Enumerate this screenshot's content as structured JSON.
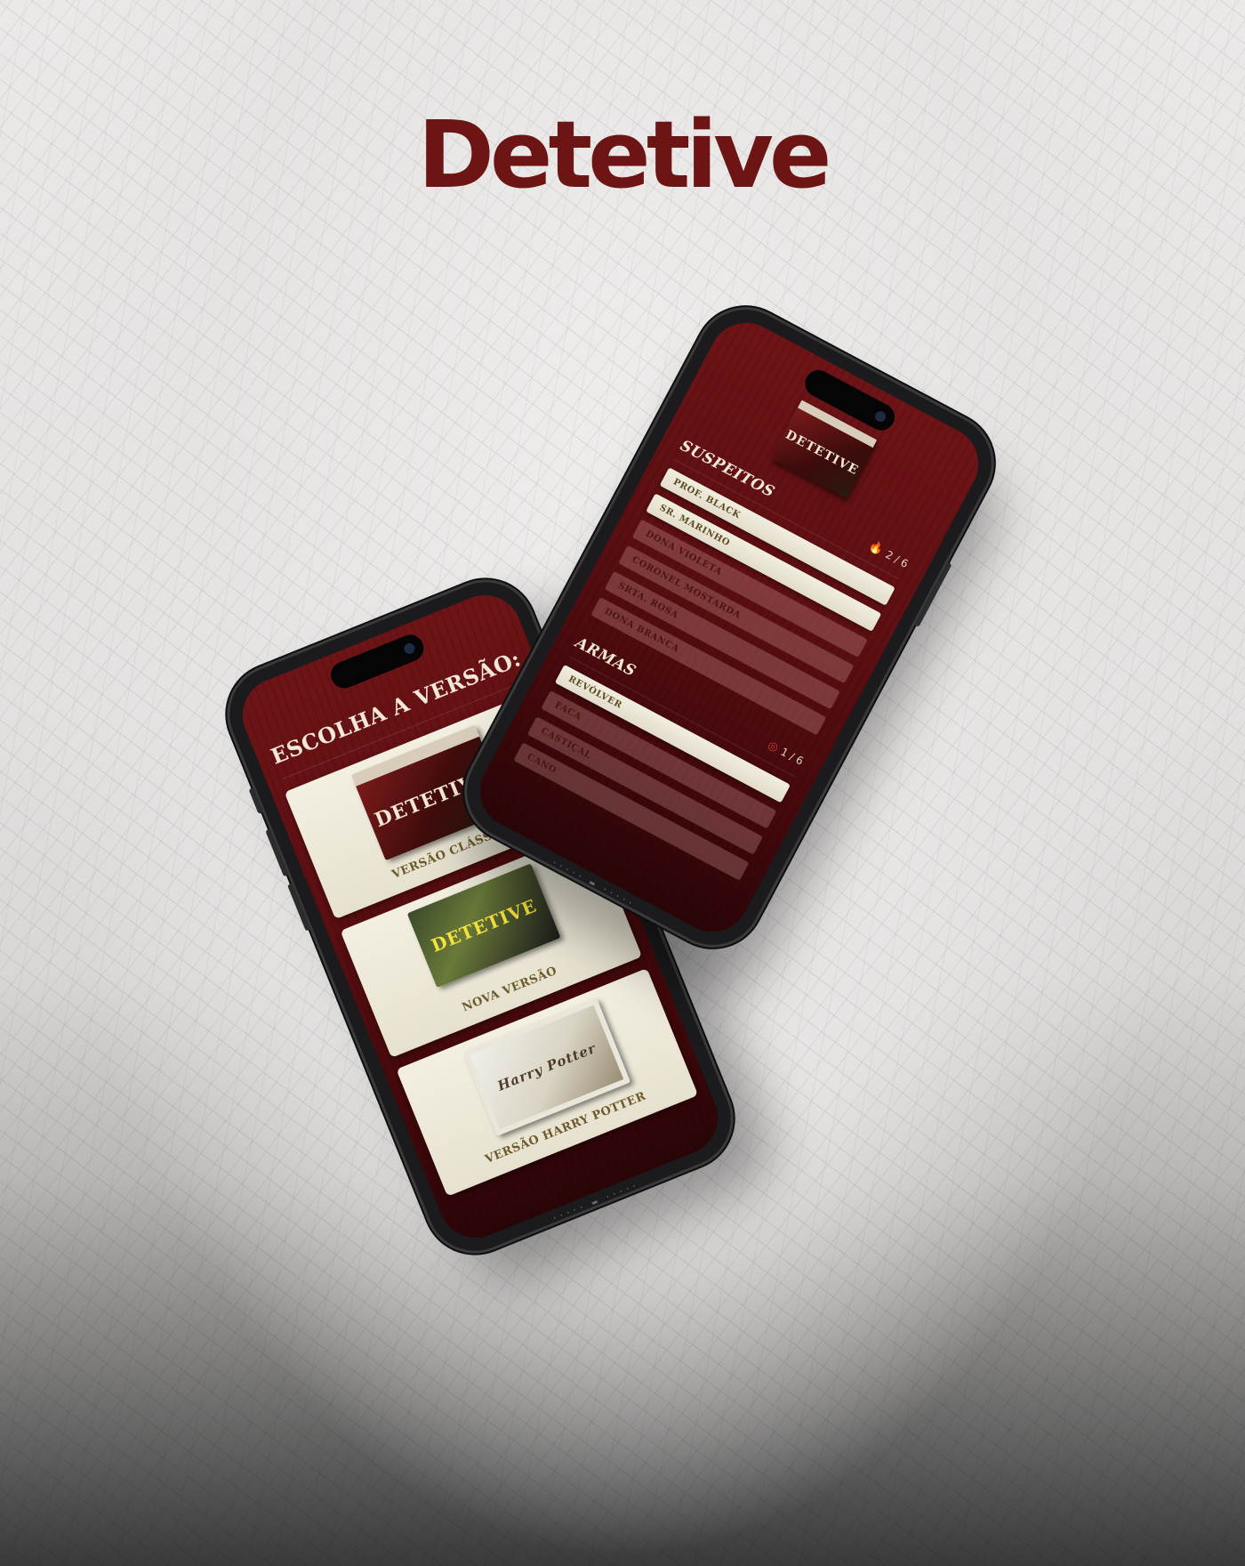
{
  "brand": {
    "title": "Detetive"
  },
  "version_screen": {
    "title": "ESCOLHA A VERSÃO:",
    "versions": [
      {
        "label": "VERSÃO CLÁSSICA",
        "box_text": "DETETIVE"
      },
      {
        "label": "NOVA VERSÃO",
        "box_text": "DETETIVE"
      },
      {
        "label": "VERSÃO HARRY POTTER",
        "box_text": "Harry Potter"
      }
    ]
  },
  "game_screen": {
    "cover_text": "DETETIVE",
    "suspects": {
      "title": "SUSPEITOS",
      "count": "2 / 6",
      "icon": "flame-icon",
      "items": [
        {
          "label": "PROF. BLACK",
          "selected": true
        },
        {
          "label": "SR. MARINHO",
          "selected": true
        },
        {
          "label": "DONA VIOLETA",
          "selected": false
        },
        {
          "label": "CORONEL MOSTARDA",
          "selected": false
        },
        {
          "label": "SRTA. ROSA",
          "selected": false
        },
        {
          "label": "DONA BRANCA",
          "selected": false
        }
      ]
    },
    "weapons": {
      "title": "ARMAS",
      "count": "1 / 6",
      "icon": "target-icon",
      "items": [
        {
          "label": "REVÓLVER",
          "selected": true
        },
        {
          "label": "FACA",
          "selected": false
        },
        {
          "label": "CASTIÇAL",
          "selected": false
        },
        {
          "label": "CANO",
          "selected": false
        }
      ]
    }
  },
  "colors": {
    "brand_red": "#6d1515",
    "screen_red": "#5d0f12",
    "card_cream": "#f2eedf"
  }
}
